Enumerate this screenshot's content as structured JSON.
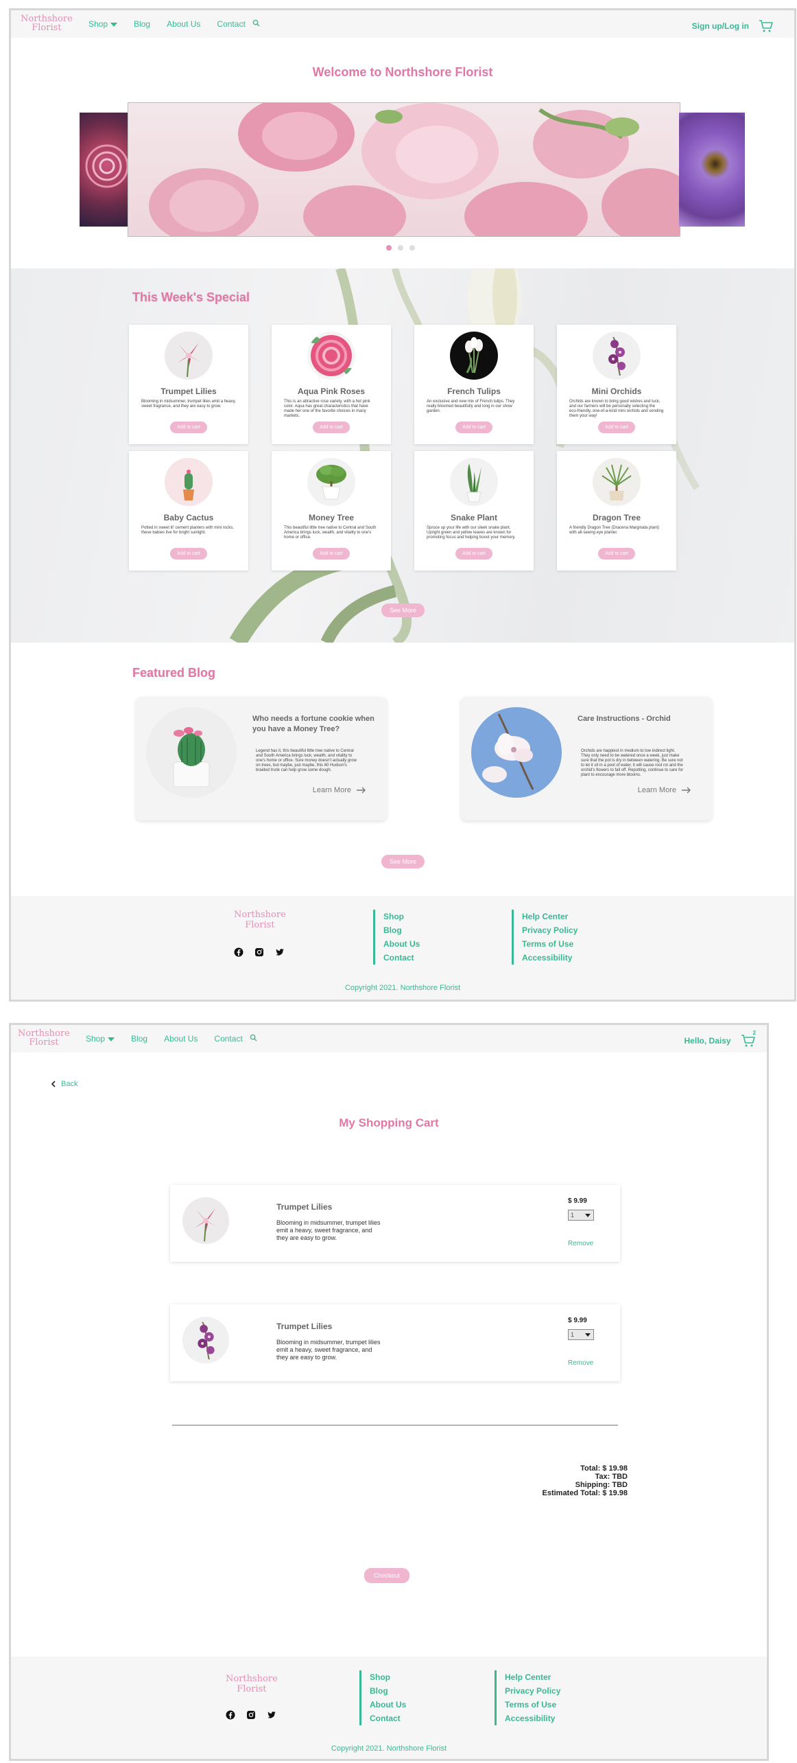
{
  "page1": {
    "nav": {
      "logo_line1": "Northshore",
      "logo_line2": "Florist",
      "links": [
        "Shop",
        "Blog",
        "About Us",
        "Contact"
      ],
      "search_icon": "search-icon",
      "signin": "Sign up/Log in",
      "cart_icon": "cart-icon"
    },
    "hero": {
      "title": "Welcome to Northshore Florist",
      "slides": [
        "rose-slide",
        "pink-ranunculus-slide",
        "purple-daisy-slide"
      ],
      "active_dot": 1
    },
    "special": {
      "title": "This Week's Special",
      "products": [
        {
          "name": "Trumpet Lilies",
          "desc": "Blooming in midsummer, trumpet lilies emit a heavy, sweet fragrance, and they are easy to grow.",
          "btn": "Add to cart"
        },
        {
          "name": "Aqua Pink Roses",
          "desc": "This is an attractive rose variety, with a hot pink color. Aqua has great characteristics that have made her one of the favorite choices in many markets.",
          "btn": "Add to cart"
        },
        {
          "name": "French Tulips",
          "desc": "An exclusive and new mix of French tulips. They really bloomed beautifully and long in our show garden.",
          "btn": "Add to cart"
        },
        {
          "name": "Mini Orchids",
          "desc": "Orchids are known to bring good wishes and luck, and our farmers will be personally selecting the eco-friendly, one-of-a-kind mini orchids and sending them your way!",
          "btn": "Add to cart"
        },
        {
          "name": "Baby Cactus",
          "desc": "Potted in sweet lil' cement planters with mini rocks, these babies live for bright sunlight.",
          "btn": "Add to cart"
        },
        {
          "name": "Money Tree",
          "desc": "This beautiful little tree native to Central and South America brings luck, wealth, and vitality to one's home or office.",
          "btn": "Add to cart"
        },
        {
          "name": "Snake Plant",
          "desc": "Spruce up your life with our sleek snake plant. Upright green and yellow leaves are known for promoting focus and helping boost your memory.",
          "btn": "Add to cart"
        },
        {
          "name": "Dragon Tree",
          "desc": "A friendly Dragon Tree (Dracena Marginata plant) with all-seeing eye planter.",
          "btn": "Add to cart"
        }
      ],
      "see_more": "See More"
    },
    "blog": {
      "title": "Featured Blog",
      "posts": [
        {
          "title": "Who needs a fortune cookie when you have a Money Tree?",
          "desc": "Legend has it, this beautiful little tree native to Central and South America brings luck, wealth, and vitality to one's home or office. Sure money doesn't actually grow on trees, but maybe, just maybe, this 60 Hudson's braided trunk can help grow some dough.",
          "learn": "Learn More"
        },
        {
          "title": "Care Instructions - Orchid",
          "desc": "Orchids are happiest in medium to low indirect light. They only need to be watered once a week, just make sure that the pot is dry in between watering. Be sure not to let it sit in a pool of water, it will cause root rot and the orchid's flowers to fall off. Repotting, continue to care for plant to encourage more blooms.",
          "learn": "Learn More"
        }
      ],
      "see_more": "See More"
    },
    "footer": {
      "logo_line1": "Northshore",
      "logo_line2": "Florist",
      "social": [
        "facebook-icon",
        "instagram-icon",
        "twitter-icon"
      ],
      "col1": [
        "Shop",
        "Blog",
        "About Us",
        "Contact"
      ],
      "col2": [
        "Help Center",
        "Privacy Policy",
        "Terms of Use",
        "Accessibility"
      ],
      "copyright": "Copyright 2021. Northshore Florist"
    }
  },
  "page2": {
    "nav": {
      "logo_line1": "Northshore",
      "logo_line2": "Florist",
      "links": [
        "Shop",
        "Blog",
        "About Us",
        "Contact"
      ],
      "greeting": "Hello, Daisy",
      "cart_count": "2"
    },
    "back": "Back",
    "title": "My Shopping Cart",
    "items": [
      {
        "name": "Trumpet Lilies",
        "desc": "Blooming in midsummer, trumpet lilies emit a heavy, sweet fragrance, and they are easy to grow.",
        "price": "$ 9.99",
        "qty": "1",
        "remove": "Remove"
      },
      {
        "name": "Trumpet Lilies",
        "desc": "Blooming in midsummer, trumpet lilies emit a heavy, sweet fragrance, and they are easy to grow.",
        "price": "$ 9.99",
        "qty": "1",
        "remove": "Remove"
      }
    ],
    "totals": {
      "total": "Total: $ 19.98",
      "tax": "Tax: TBD",
      "shipping": "Shipping: TBD",
      "estimated": "Estimated Total: $ 19.98"
    },
    "checkout": "Checkout",
    "footer": {
      "logo_line1": "Northshore",
      "logo_line2": "Florist",
      "col1": [
        "Shop",
        "Blog",
        "About Us",
        "Contact"
      ],
      "col2": [
        "Help Center",
        "Privacy Policy",
        "Terms of Use",
        "Accessibility"
      ],
      "copyright": "Copyright 2021. Northshore Florist"
    }
  }
}
